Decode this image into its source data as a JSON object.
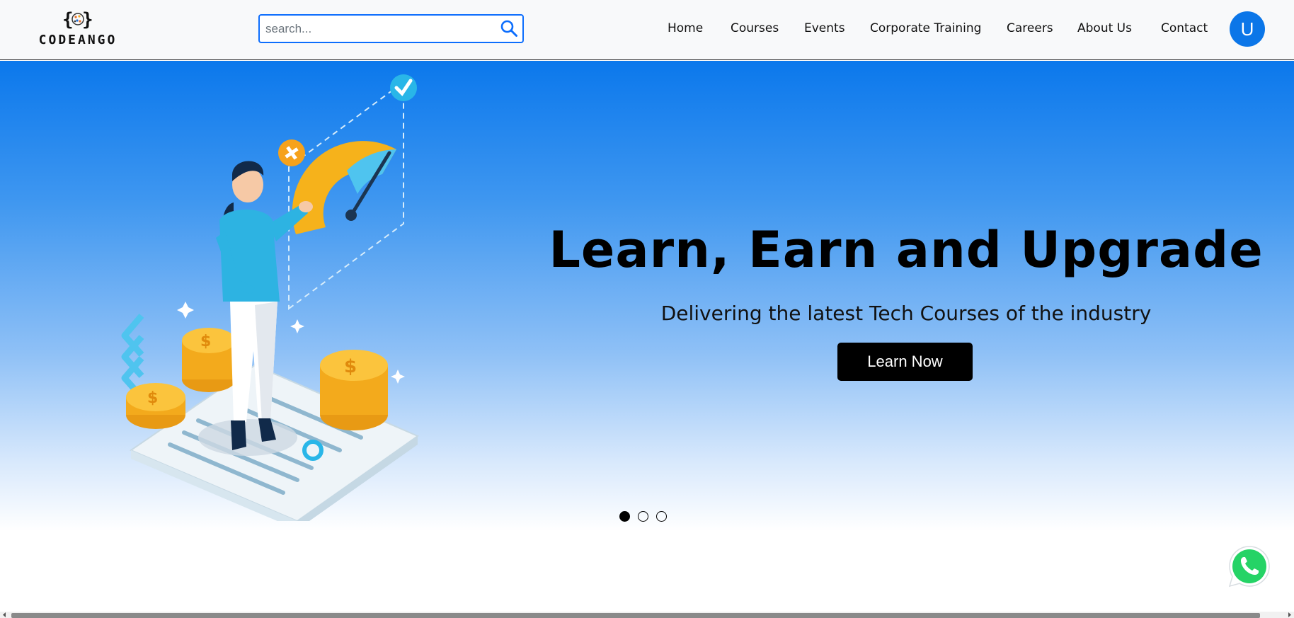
{
  "brand": {
    "name": "CODEANGO",
    "logo_icon": "brain-braces-icon"
  },
  "search": {
    "placeholder": "search...",
    "value": "",
    "icon": "search-icon"
  },
  "nav": {
    "items": [
      {
        "label": "Home"
      },
      {
        "label": "Courses"
      },
      {
        "label": "Events"
      },
      {
        "label": "Corporate Training"
      },
      {
        "label": "Careers"
      },
      {
        "label": "About Us"
      },
      {
        "label": "Contact"
      }
    ],
    "avatar_initial": "U"
  },
  "hero": {
    "title": "Learn, Earn and Upgrade",
    "subtitle": "Delivering the latest Tech Courses of the industry",
    "cta_label": "Learn Now",
    "illustration": "woman-with-gauge-and-coins-illustration",
    "slides": {
      "count": 3,
      "active": 1
    }
  },
  "floating": {
    "icon": "whatsapp-icon"
  },
  "colors": {
    "accent": "#0b76e8",
    "hero_top": "#0b78ec",
    "button_bg": "#000000",
    "whatsapp": "#25d366"
  }
}
